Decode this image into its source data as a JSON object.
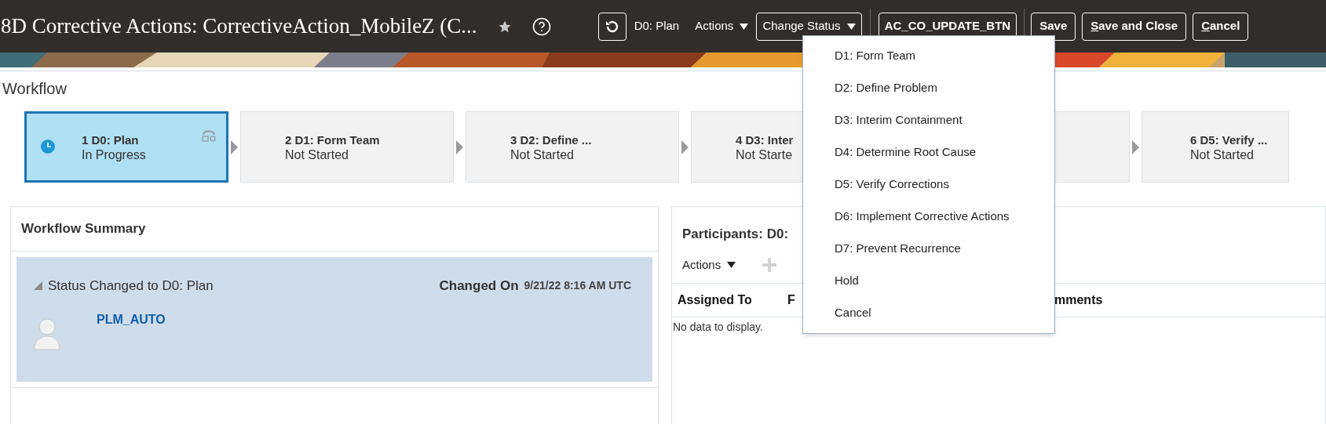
{
  "header": {
    "title": "8D Corrective Actions: CorrectiveAction_MobileZ (C...",
    "status": "D0: Plan",
    "actions_menu": "Actions",
    "change_status": "Change Status",
    "custom_button": "AC_CO_UPDATE_BTN",
    "buttons": [
      {
        "label": "Save",
        "underline_first": false
      },
      {
        "label": "Save and Close",
        "underline_first": true
      },
      {
        "label": "Cancel",
        "underline_first": true
      }
    ]
  },
  "workflow": {
    "title": "Workflow",
    "steps": [
      {
        "label": "1 D0: Plan",
        "status": "In Progress",
        "current": true
      },
      {
        "label": "2 D1: Form Team",
        "status": "Not Started",
        "current": false
      },
      {
        "label": "3 D2: Define ...",
        "status": "Not Started",
        "current": false
      },
      {
        "label": "4 D3: Inter",
        "status": "Not Starte",
        "current": false
      },
      {
        "current": false
      },
      {
        "label": "6 D5: Verify ...",
        "status": "Not Started",
        "current": false
      }
    ]
  },
  "summary": {
    "title": "Workflow Summary",
    "event": "Status Changed to D0: Plan",
    "changed_on_label": "Changed On",
    "changed_on": "9/21/22 8:16 AM UTC",
    "user": "PLM_AUTO"
  },
  "participants": {
    "title": "Participants: D0:",
    "actions": "Actions",
    "columns": [
      "Assigned To",
      "F",
      "mments"
    ],
    "empty": "No data to display."
  },
  "status_menu": [
    "D1: Form Team",
    "D2: Define Problem",
    "D3: Interim Containment",
    "D4: Determine Root Cause",
    "D5: Verify Corrections",
    "D6: Implement Corrective Actions",
    "D7: Prevent Recurrence",
    "Hold",
    "Cancel"
  ]
}
